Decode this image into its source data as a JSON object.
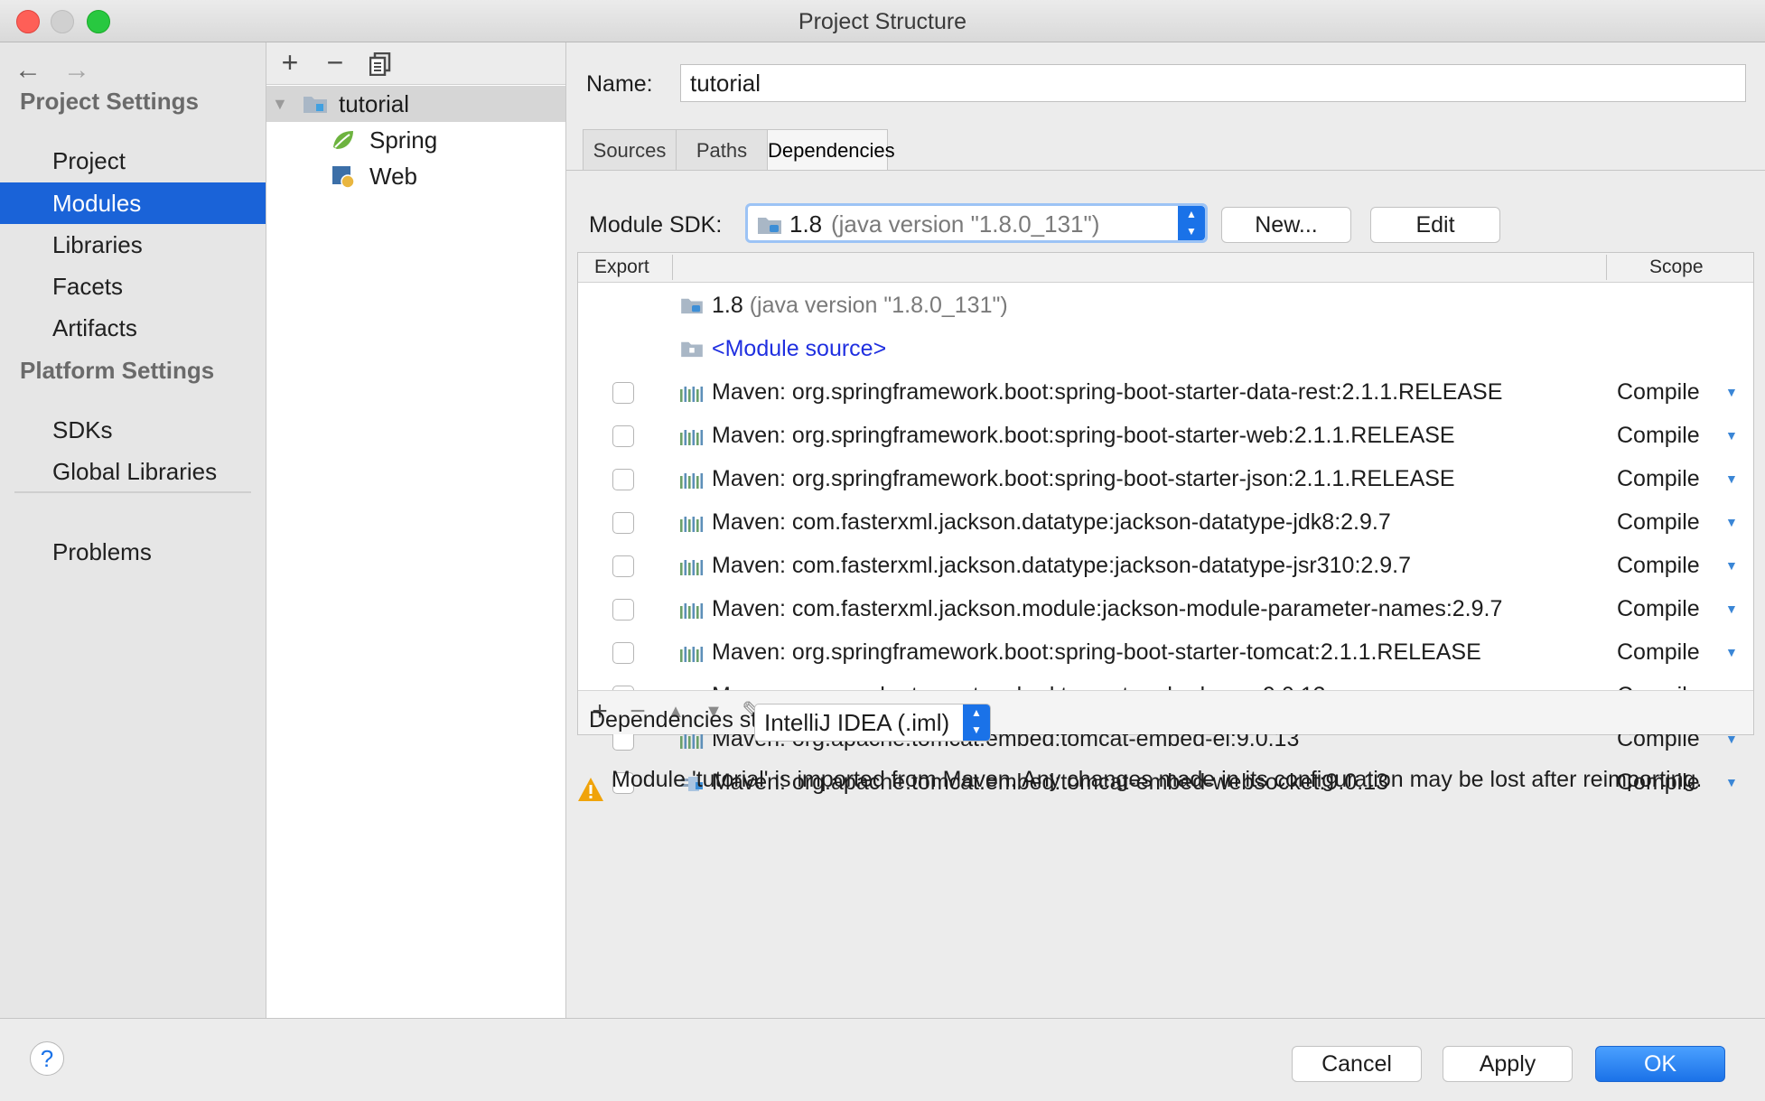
{
  "window": {
    "title": "Project Structure"
  },
  "nav": {
    "sections": [
      {
        "heading": "Project Settings",
        "items": [
          "Project",
          "Modules",
          "Libraries",
          "Facets",
          "Artifacts"
        ]
      },
      {
        "heading": "Platform Settings",
        "items": [
          "SDKs",
          "Global Libraries"
        ]
      }
    ],
    "problems": "Problems",
    "selected": "Modules"
  },
  "tree": {
    "root": "tutorial",
    "children": [
      "Spring",
      "Web"
    ]
  },
  "module": {
    "name_label": "Name:",
    "name_value": "tutorial",
    "tabs": [
      "Sources",
      "Paths",
      "Dependencies"
    ],
    "active_tab": "Dependencies",
    "sdk_label": "Module SDK:",
    "sdk_value_main": "1.8",
    "sdk_value_detail": "(java version \"1.8.0_131\")",
    "new_button": "New...",
    "edit_button": "Edit"
  },
  "dependencies": {
    "headers": {
      "export": "Export",
      "scope": "Scope"
    },
    "jdk_main": "1.8",
    "jdk_detail": "(java version \"1.8.0_131\")",
    "module_source": "<Module source>",
    "rows": [
      {
        "name": "Maven: org.springframework.boot:spring-boot-starter-data-rest:2.1.1.RELEASE",
        "scope": "Compile"
      },
      {
        "name": "Maven: org.springframework.boot:spring-boot-starter-web:2.1.1.RELEASE",
        "scope": "Compile"
      },
      {
        "name": "Maven: org.springframework.boot:spring-boot-starter-json:2.1.1.RELEASE",
        "scope": "Compile"
      },
      {
        "name": "Maven: com.fasterxml.jackson.datatype:jackson-datatype-jdk8:2.9.7",
        "scope": "Compile"
      },
      {
        "name": "Maven: com.fasterxml.jackson.datatype:jackson-datatype-jsr310:2.9.7",
        "scope": "Compile"
      },
      {
        "name": "Maven: com.fasterxml.jackson.module:jackson-module-parameter-names:2.9.7",
        "scope": "Compile"
      },
      {
        "name": "Maven: org.springframework.boot:spring-boot-starter-tomcat:2.1.1.RELEASE",
        "scope": "Compile"
      },
      {
        "name": "Maven: org.apache.tomcat.embed:tomcat-embed-core:9.0.13",
        "scope": "Compile"
      },
      {
        "name": "Maven: org.apache.tomcat.embed:tomcat-embed-el:9.0.13",
        "scope": "Compile"
      },
      {
        "name": "Maven: org.apache.tomcat.embed:tomcat-embed-websocket:9.0.13",
        "scope": "Compile"
      }
    ],
    "storage_label": "Dependencies storage format:",
    "storage_value": "IntelliJ IDEA (.iml)"
  },
  "warning": "Module 'tutorial' is imported from Maven. Any changes made in its configuration may be lost after reimporting.",
  "footer": {
    "help": "?",
    "cancel": "Cancel",
    "apply": "Apply",
    "ok": "OK"
  },
  "colors": {
    "accent": "#1a63d8",
    "link": "#1f2fe0"
  }
}
